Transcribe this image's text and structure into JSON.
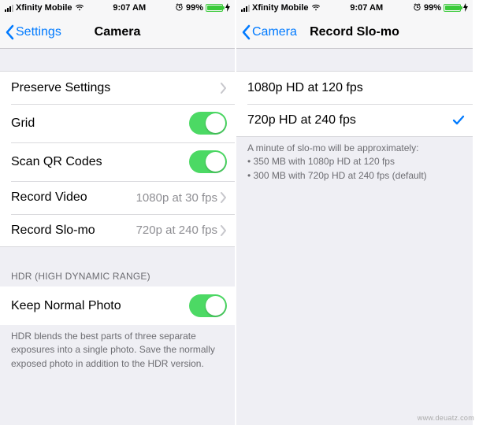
{
  "left": {
    "status": {
      "carrier": "Xfinity Mobile",
      "time": "9:07 AM",
      "battery_pct": "99%"
    },
    "nav": {
      "back": "Settings",
      "title": "Camera"
    },
    "rows": {
      "preserve": "Preserve Settings",
      "grid": "Grid",
      "qr": "Scan QR Codes",
      "rec_video": {
        "label": "Record Video",
        "detail": "1080p at 30 fps"
      },
      "rec_slomo": {
        "label": "Record Slo-mo",
        "detail": "720p at 240 fps"
      }
    },
    "hdr": {
      "header": "HDR (High Dynamic Range)",
      "keep": "Keep Normal Photo",
      "footer": "HDR blends the best parts of three separate exposures into a single photo. Save the normally exposed photo in addition to the HDR version."
    }
  },
  "right": {
    "status": {
      "carrier": "Xfinity Mobile",
      "time": "9:07 AM",
      "battery_pct": "99%"
    },
    "nav": {
      "back": "Camera",
      "title": "Record Slo-mo"
    },
    "options": {
      "o1": "1080p HD at 120 fps",
      "o2": "720p HD at 240 fps"
    },
    "footer": {
      "line": "A minute of slo-mo will be approximately:",
      "b1": "350 MB with 1080p HD at 120 fps",
      "b2": "300 MB with 720p HD at 240 fps (default)"
    }
  },
  "watermark": "www.deuatz.com"
}
